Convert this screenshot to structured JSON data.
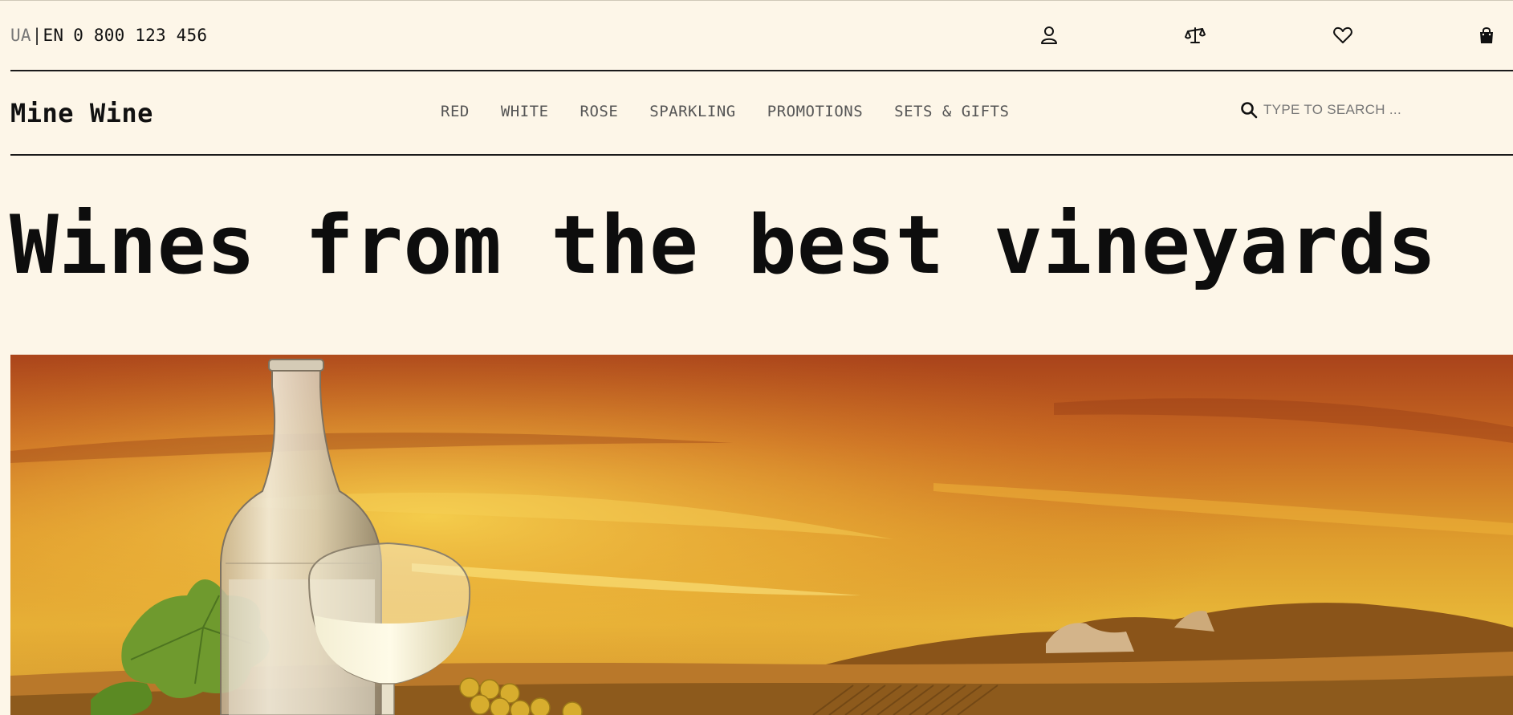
{
  "topbar": {
    "lang_ua": "UA",
    "lang_separator": "|",
    "lang_en": "EN",
    "phone": "0 800 123 456",
    "icons": [
      "user-icon",
      "compare-scales-icon",
      "heart-icon",
      "shopping-bag-icon"
    ]
  },
  "nav": {
    "logo": "Mine Wine",
    "links": [
      "RED",
      "WHITE",
      "ROSE",
      "SPARKLING",
      "PROMOTIONS",
      "SETS & GIFTS"
    ],
    "search_placeholder": "TYPE TO SEARCH ..."
  },
  "hero": {
    "title": "Wines from the best vineyards"
  },
  "colors": {
    "background": "#fdf6e8",
    "text": "#111111",
    "nav_link": "#555555",
    "sky_top": "#b34a1c",
    "sky_glow": "#f2c13a"
  }
}
